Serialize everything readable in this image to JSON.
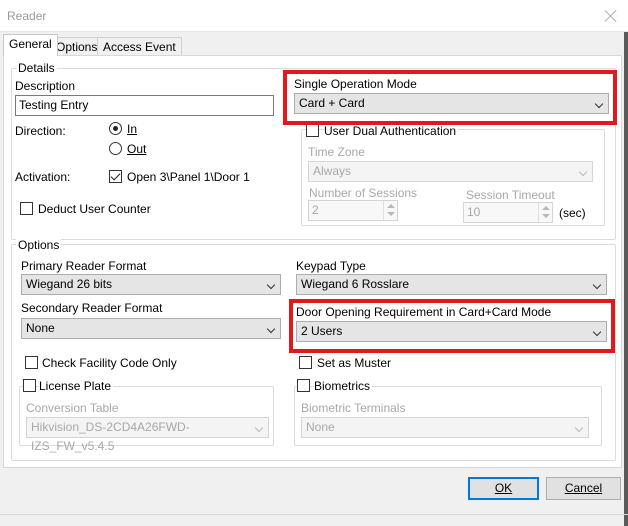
{
  "window": {
    "title": "Reader"
  },
  "tabs": [
    "General",
    "Options",
    "Access Event"
  ],
  "details": {
    "group_title": "Details",
    "description_label": "Description",
    "description_value": "Testing Entry",
    "direction_label": "Direction:",
    "direction_options": [
      "In",
      "Out"
    ],
    "direction_selected": "In",
    "activation_label": "Activation:",
    "activation_value": "Open 3\\Panel 1\\Door 1",
    "activation_checked": true,
    "deduct_user_counter_label": "Deduct User Counter",
    "deduct_user_counter_checked": false,
    "single_operation_mode_label": "Single Operation Mode",
    "single_operation_mode_value": "Card + Card",
    "user_dual_auth_label": "User Dual Authentication",
    "user_dual_auth_checked": false,
    "time_zone_label": "Time Zone",
    "time_zone_value": "Always",
    "number_of_sessions_label": "Number of Sessions",
    "number_of_sessions_value": "2",
    "session_timeout_label": "Session Timeout",
    "session_timeout_value": "10",
    "session_timeout_unit": "(sec)"
  },
  "options": {
    "group_title": "Options",
    "primary_reader_format_label": "Primary Reader Format",
    "primary_reader_format_value": "Wiegand 26 bits",
    "keypad_type_label": "Keypad Type",
    "keypad_type_value": "Wiegand 6 Rosslare",
    "secondary_reader_format_label": "Secondary Reader Format",
    "secondary_reader_format_value": "None",
    "door_opening_req_label": "Door Opening Requirement in Card+Card Mode",
    "door_opening_req_value": "2 Users",
    "check_facility_code_label": "Check Facility Code Only",
    "set_as_muster_label": "Set as Muster",
    "license_plate_label": "License Plate",
    "conversion_table_label": "Conversion Table",
    "conversion_table_value": "Hikvision_DS-2CD4A26FWD-IZS_FW_v5.4.5",
    "biometrics_label": "Biometrics",
    "biometric_terminals_label": "Biometric Terminals",
    "biometric_terminals_value": "None"
  },
  "buttons": {
    "ok": "OK",
    "cancel": "Cancel"
  },
  "colors": {
    "highlight": "#e0191e",
    "default_button_border": "#0078d7"
  }
}
